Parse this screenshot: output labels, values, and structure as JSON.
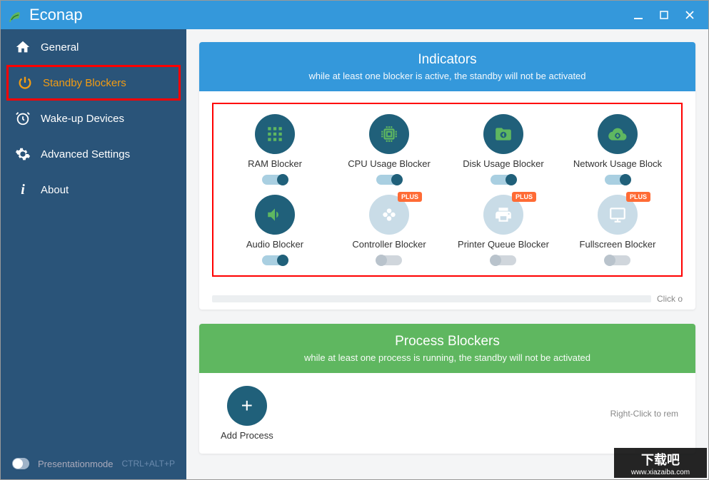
{
  "app": {
    "name": "Econap"
  },
  "sidebar": {
    "items": [
      {
        "label": "General"
      },
      {
        "label": "Standby Blockers"
      },
      {
        "label": "Wake-up Devices"
      },
      {
        "label": "Advanced Settings"
      },
      {
        "label": "About"
      }
    ],
    "footer": {
      "presentation_label": "Presentationmode",
      "shortcut": "CTRL+ALT+P"
    }
  },
  "indicators_panel": {
    "title": "Indicators",
    "subtitle": "while at least one blocker is active, the standby will not be activated",
    "click_hint": "Click o",
    "items": [
      {
        "label": "RAM Blocker",
        "enabled": true,
        "plus": false
      },
      {
        "label": "CPU Usage Blocker",
        "enabled": true,
        "plus": false
      },
      {
        "label": "Disk Usage Blocker",
        "enabled": true,
        "plus": false
      },
      {
        "label": "Network Usage Block",
        "enabled": true,
        "plus": false
      },
      {
        "label": "Audio Blocker",
        "enabled": true,
        "plus": false
      },
      {
        "label": "Controller Blocker",
        "enabled": false,
        "plus": true
      },
      {
        "label": "Printer Queue Blocker",
        "enabled": false,
        "plus": true
      },
      {
        "label": "Fullscreen Blocker",
        "enabled": false,
        "plus": true
      }
    ],
    "plus_badge": "PLUS"
  },
  "processes_panel": {
    "title": "Process Blockers",
    "subtitle": "while at least one process is running, the standby will not be activated",
    "add_label": "Add Process",
    "right_hint": "Right-Click to rem"
  },
  "watermark": {
    "main": "下载吧",
    "url": "www.xiazaiba.com"
  }
}
